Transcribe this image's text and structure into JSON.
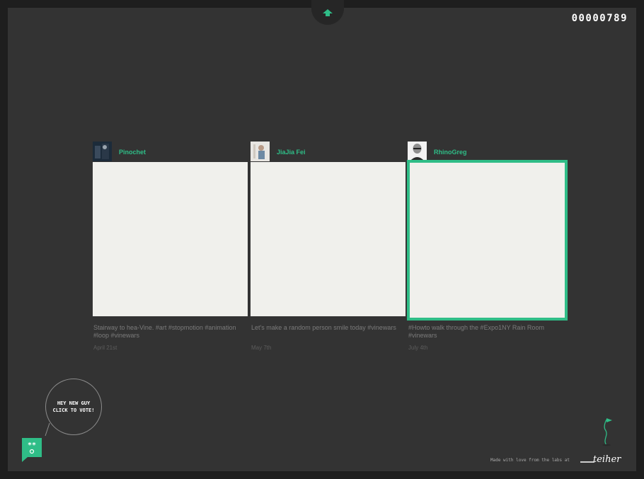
{
  "header": {
    "nav_icon": "chevron-up-icon",
    "counter": "00000789"
  },
  "cards": [
    {
      "username": "Pinochet",
      "caption": "Stairway to hea-Vine. #art #stopmotion #animation #loop #vinewars",
      "date": "April 21st",
      "selected": false
    },
    {
      "username": "JiaJia Fei",
      "caption": "Let's make a random person smile today #vinewars",
      "date": "May 7th",
      "selected": false
    },
    {
      "username": "RhinoGreg",
      "caption": "#Howto walk through the #Expo1NY Rain Room #vinewars",
      "date": "July 4th",
      "selected": true
    }
  ],
  "vote_prompt": {
    "line1": "HEY NEW GUY",
    "line2": "CLICK TO VOTE!"
  },
  "footer": {
    "made_with": "Made with love from the labs at",
    "logo_text": "teiher"
  },
  "colors": {
    "accent": "#2fbd87",
    "background": "#333333",
    "card": "#f0f0ec"
  }
}
